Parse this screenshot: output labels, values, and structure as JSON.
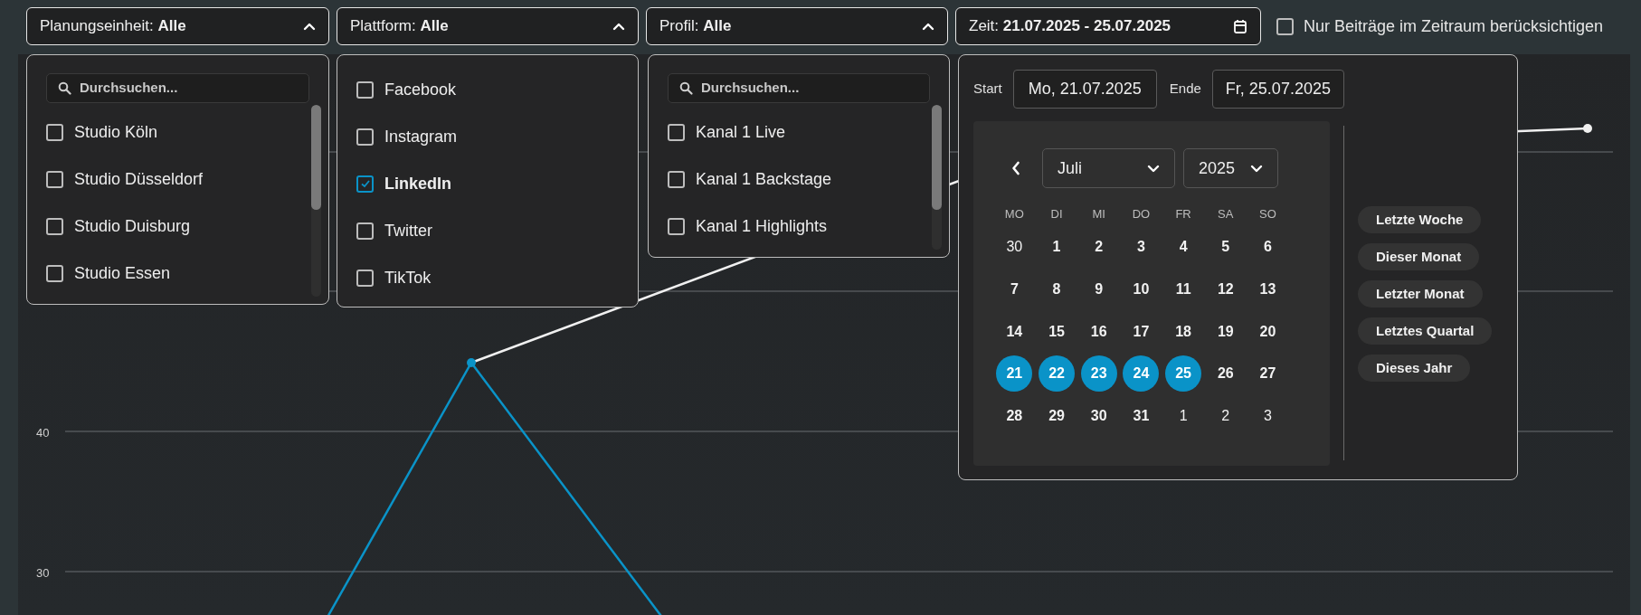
{
  "filters": [
    {
      "kind": "dropdown",
      "label": "Planungseinheit:",
      "value": "Alle",
      "expanded": true,
      "panel": {
        "search_placeholder": "Durchsuchen...",
        "scrollable": true,
        "options": [
          {
            "label": "Studio Köln",
            "checked": false
          },
          {
            "label": "Studio Düsseldorf",
            "checked": false
          },
          {
            "label": "Studio Duisburg",
            "checked": false
          },
          {
            "label": "Studio Essen",
            "checked": false
          }
        ]
      }
    },
    {
      "kind": "dropdown",
      "label": "Plattform:",
      "value": "Alle",
      "expanded": true,
      "panel": {
        "scrollable": false,
        "options": [
          {
            "label": "Facebook",
            "checked": false
          },
          {
            "label": "Instagram",
            "checked": false
          },
          {
            "label": "LinkedIn",
            "checked": true
          },
          {
            "label": "Twitter",
            "checked": false
          },
          {
            "label": "TikTok",
            "checked": false
          }
        ]
      }
    },
    {
      "kind": "dropdown",
      "label": "Profil:",
      "value": "Alle",
      "expanded": true,
      "panel": {
        "search_placeholder": "Durchsuchen...",
        "scrollable": true,
        "options": [
          {
            "label": "Kanal 1 Live",
            "checked": false
          },
          {
            "label": "Kanal 1 Backstage",
            "checked": false
          },
          {
            "label": "Kanal 1 Highlights",
            "checked": false
          }
        ]
      }
    },
    {
      "kind": "date",
      "label": "Zeit:",
      "value": "21.07.2025 - 25.07.2025",
      "expanded": true
    }
  ],
  "period_checkbox": {
    "label": "Nur Beiträge im Zeitraum berücksichtigen",
    "checked": false
  },
  "date_picker": {
    "start_label": "Start",
    "start_value": "Mo, 21.07.2025",
    "end_label": "Ende",
    "end_value": "Fr, 25.07.2025",
    "month": "Juli",
    "year": "2025",
    "weekdays": [
      "MO",
      "DI",
      "MI",
      "DO",
      "FR",
      "SA",
      "SO"
    ],
    "days": [
      {
        "label": "30",
        "outside": true,
        "selected": false
      },
      {
        "label": "1",
        "outside": false,
        "selected": false
      },
      {
        "label": "2",
        "outside": false,
        "selected": false
      },
      {
        "label": "3",
        "outside": false,
        "selected": false
      },
      {
        "label": "4",
        "outside": false,
        "selected": false
      },
      {
        "label": "5",
        "outside": false,
        "selected": false
      },
      {
        "label": "6",
        "outside": false,
        "selected": false
      },
      {
        "label": "7",
        "outside": false,
        "selected": false
      },
      {
        "label": "8",
        "outside": false,
        "selected": false
      },
      {
        "label": "9",
        "outside": false,
        "selected": false
      },
      {
        "label": "10",
        "outside": false,
        "selected": false
      },
      {
        "label": "11",
        "outside": false,
        "selected": false
      },
      {
        "label": "12",
        "outside": false,
        "selected": false
      },
      {
        "label": "13",
        "outside": false,
        "selected": false
      },
      {
        "label": "14",
        "outside": false,
        "selected": false
      },
      {
        "label": "15",
        "outside": false,
        "selected": false
      },
      {
        "label": "16",
        "outside": false,
        "selected": false
      },
      {
        "label": "17",
        "outside": false,
        "selected": false
      },
      {
        "label": "18",
        "outside": false,
        "selected": false
      },
      {
        "label": "19",
        "outside": false,
        "selected": false
      },
      {
        "label": "20",
        "outside": false,
        "selected": false
      },
      {
        "label": "21",
        "outside": false,
        "selected": true
      },
      {
        "label": "22",
        "outside": false,
        "selected": true
      },
      {
        "label": "23",
        "outside": false,
        "selected": true
      },
      {
        "label": "24",
        "outside": false,
        "selected": true
      },
      {
        "label": "25",
        "outside": false,
        "selected": true
      },
      {
        "label": "26",
        "outside": false,
        "selected": false
      },
      {
        "label": "27",
        "outside": false,
        "selected": false
      },
      {
        "label": "28",
        "outside": false,
        "selected": false
      },
      {
        "label": "29",
        "outside": false,
        "selected": false
      },
      {
        "label": "30",
        "outside": false,
        "selected": false
      },
      {
        "label": "31",
        "outside": false,
        "selected": false
      },
      {
        "label": "1",
        "outside": true,
        "selected": false
      },
      {
        "label": "2",
        "outside": true,
        "selected": false
      },
      {
        "label": "3",
        "outside": true,
        "selected": false
      }
    ],
    "presets": [
      "Letzte Woche",
      "Dieser Monat",
      "Letzter Monat",
      "Letztes Quartal",
      "Dieses Jahr"
    ]
  },
  "chart": {
    "y_labels": [
      "40",
      "30"
    ]
  }
}
